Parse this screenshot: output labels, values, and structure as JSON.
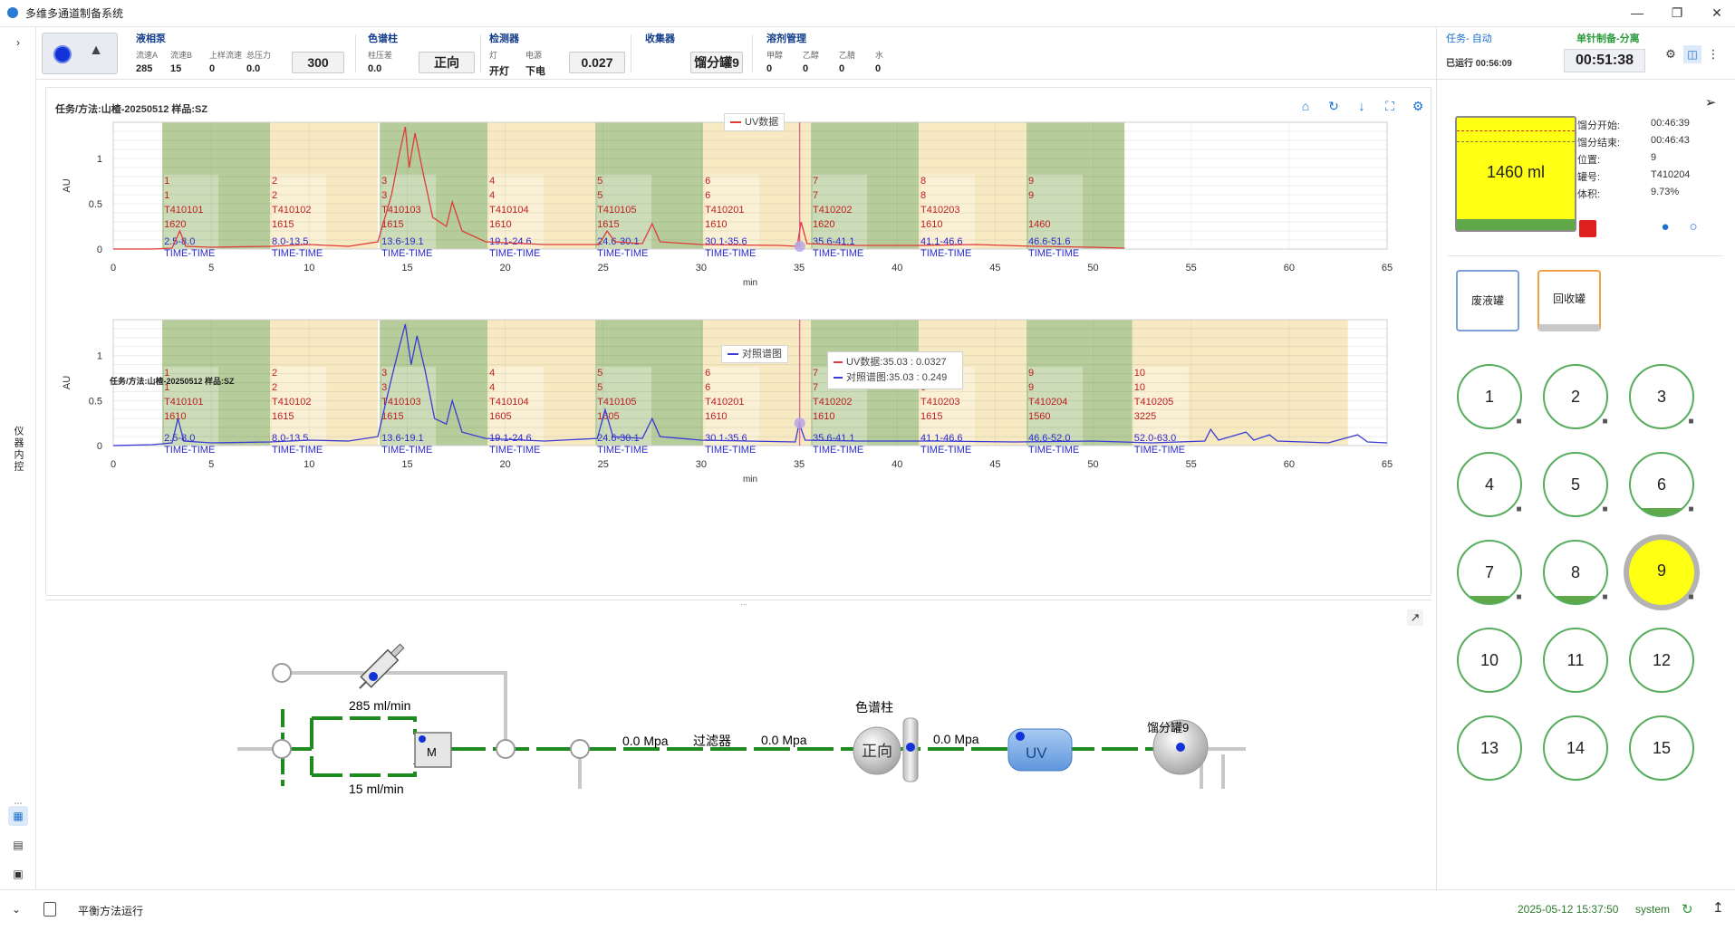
{
  "window": {
    "title": "多维多通道制备系统"
  },
  "left_rail": {
    "vertical_label": "仪器内控"
  },
  "toolbar": {
    "pump": {
      "title": "液相泵",
      "labels": [
        "流速A",
        "流速B",
        "上样流速",
        "总压力"
      ],
      "values": [
        "285",
        "15",
        "0",
        "0.0"
      ],
      "box": "300"
    },
    "column": {
      "title": "色谱柱",
      "label": "柱压差",
      "value": "0.0",
      "box": "正向"
    },
    "detector": {
      "title": "检测器",
      "labels": [
        "灯",
        "电源"
      ],
      "values": [
        "开灯",
        "下电"
      ],
      "box": "0.027"
    },
    "collector": {
      "title": "收集器",
      "box": "馏分罐9"
    },
    "solvent": {
      "title": "溶剂管理",
      "labels": [
        "甲醇",
        "乙醇",
        "乙腈",
        "水"
      ],
      "values": [
        "0",
        "0",
        "0",
        "0"
      ]
    }
  },
  "task": {
    "label": "任务- 自动",
    "mode": "单针制备-分离",
    "elapsed_label": "已运行 00:56:09",
    "timer": "00:51:38"
  },
  "chart1": {
    "title": "任务/方法:山楂-20250512 样品:SZ",
    "legend": "UV数据"
  },
  "chart2": {
    "title": "任务/方法:山楂-20250512 样品:SZ",
    "legend": "对照谱图",
    "tooltip": [
      "UV数据:35.03 : 0.0327",
      "对照谱图:35.03 : 0.249"
    ]
  },
  "chart_data": [
    {
      "type": "line",
      "title": "任务/方法:山楂-20250512 样品:SZ",
      "xlabel": "min",
      "ylabel": "AU",
      "xlim": [
        0,
        65
      ],
      "ylim": [
        0,
        1.4
      ],
      "x_ticks": [
        0,
        5,
        10,
        15,
        20,
        25,
        30,
        35,
        40,
        45,
        50,
        55,
        60,
        65
      ],
      "y_ticks": [
        0,
        0.5,
        1
      ],
      "series": [
        {
          "name": "UV数据",
          "color": "#e03b3b",
          "points": [
            [
              0,
              0
            ],
            [
              2,
              0
            ],
            [
              3,
              0.01
            ],
            [
              3.4,
              0.2
            ],
            [
              3.7,
              0.03
            ],
            [
              5,
              0.02
            ],
            [
              8,
              0.03
            ],
            [
              10,
              0.05
            ],
            [
              12,
              0.03
            ],
            [
              13.5,
              0.08
            ],
            [
              14.2,
              0.6
            ],
            [
              14.6,
              1.05
            ],
            [
              14.9,
              1.35
            ],
            [
              15.1,
              0.9
            ],
            [
              15.4,
              1.28
            ],
            [
              15.8,
              0.85
            ],
            [
              16.3,
              0.35
            ],
            [
              17,
              0.25
            ],
            [
              17.3,
              0.52
            ],
            [
              17.8,
              0.2
            ],
            [
              19,
              0.08
            ],
            [
              22,
              0.05
            ],
            [
              24.8,
              0.05
            ],
            [
              25.2,
              0.2
            ],
            [
              25.6,
              0.08
            ],
            [
              27,
              0.06
            ],
            [
              27.5,
              0.28
            ],
            [
              27.9,
              0.08
            ],
            [
              30,
              0.05
            ],
            [
              34,
              0.04
            ],
            [
              34.9,
              0.03
            ],
            [
              35.1,
              0.3
            ],
            [
              35.4,
              0.06
            ],
            [
              38,
              0.04
            ],
            [
              41,
              0.04
            ],
            [
              44,
              0.05
            ],
            [
              47,
              0.03
            ],
            [
              50,
              0.02
            ],
            [
              51.6,
              0.01
            ]
          ]
        }
      ],
      "fractions": [
        {
          "no": "1",
          "ch": "1",
          "tube": "T410101",
          "vol": "1620",
          "range": "2.5-8.0",
          "start": 2.5,
          "end": 8.0
        },
        {
          "no": "2",
          "ch": "2",
          "tube": "T410102",
          "vol": "1615",
          "range": "8.0-13.5",
          "start": 8.0,
          "end": 13.5
        },
        {
          "no": "3",
          "ch": "3",
          "tube": "T410103",
          "vol": "1615",
          "range": "13.6-19.1",
          "start": 13.6,
          "end": 19.1
        },
        {
          "no": "4",
          "ch": "4",
          "tube": "T410104",
          "vol": "1610",
          "range": "19.1-24.6",
          "start": 19.1,
          "end": 24.6
        },
        {
          "no": "5",
          "ch": "5",
          "tube": "T410105",
          "vol": "1615",
          "range": "24.6-30.1",
          "start": 24.6,
          "end": 30.1
        },
        {
          "no": "6",
          "ch": "6",
          "tube": "T410201",
          "vol": "1610",
          "range": "30.1-35.6",
          "start": 30.1,
          "end": 35.6
        },
        {
          "no": "7",
          "ch": "7",
          "tube": "T410202",
          "vol": "1620",
          "range": "35.6-41.1",
          "start": 35.6,
          "end": 41.1
        },
        {
          "no": "8",
          "ch": "8",
          "tube": "T410203",
          "vol": "1610",
          "range": "41.1-46.6",
          "start": 41.1,
          "end": 46.6
        },
        {
          "no": "9",
          "ch": "9",
          "tube": "",
          "vol": "1460",
          "range": "46.6-51.6",
          "start": 46.6,
          "end": 51.6
        }
      ],
      "fraction_suffix": "TIME-TIME",
      "cursor_x": 35.03
    },
    {
      "type": "line",
      "title": "任务/方法:山楂-20250512 样品:SZ",
      "xlabel": "min",
      "ylabel": "AU",
      "xlim": [
        0,
        65
      ],
      "ylim": [
        0,
        1.4
      ],
      "x_ticks": [
        0,
        5,
        10,
        15,
        20,
        25,
        30,
        35,
        40,
        45,
        50,
        55,
        60,
        65
      ],
      "y_ticks": [
        0,
        0.5,
        1
      ],
      "series": [
        {
          "name": "对照谱图",
          "color": "#3a3ad6",
          "points": [
            [
              0,
              0
            ],
            [
              2,
              0.01
            ],
            [
              3,
              0.03
            ],
            [
              3.3,
              0.3
            ],
            [
              3.6,
              0.05
            ],
            [
              5,
              0.03
            ],
            [
              8,
              0.04
            ],
            [
              10,
              0.06
            ],
            [
              12,
              0.05
            ],
            [
              13.5,
              0.1
            ],
            [
              14.2,
              0.75
            ],
            [
              14.6,
              1.1
            ],
            [
              14.9,
              1.35
            ],
            [
              15.2,
              0.9
            ],
            [
              15.5,
              1.22
            ],
            [
              15.9,
              0.85
            ],
            [
              16.4,
              0.3
            ],
            [
              17,
              0.24
            ],
            [
              17.3,
              0.5
            ],
            [
              17.8,
              0.15
            ],
            [
              19,
              0.08
            ],
            [
              22,
              0.05
            ],
            [
              24.7,
              0.08
            ],
            [
              25.1,
              0.4
            ],
            [
              25.5,
              0.1
            ],
            [
              27,
              0.08
            ],
            [
              27.5,
              0.3
            ],
            [
              27.9,
              0.1
            ],
            [
              30,
              0.06
            ],
            [
              34.8,
              0.04
            ],
            [
              35.0,
              0.25
            ],
            [
              35.3,
              0.06
            ],
            [
              38,
              0.05
            ],
            [
              42,
              0.05
            ],
            [
              46,
              0.04
            ],
            [
              50,
              0.05
            ],
            [
              53,
              0.03
            ],
            [
              55.7,
              0.05
            ],
            [
              56,
              0.18
            ],
            [
              56.4,
              0.06
            ],
            [
              57.8,
              0.15
            ],
            [
              58.2,
              0.06
            ],
            [
              59,
              0.12
            ],
            [
              59.4,
              0.05
            ],
            [
              62,
              0.03
            ],
            [
              63.5,
              0.12
            ],
            [
              64,
              0.04
            ],
            [
              65,
              0.03
            ]
          ]
        }
      ],
      "fractions": [
        {
          "no": "1",
          "ch": "1",
          "tube": "T410101",
          "vol": "1610",
          "range": "2.5-8.0",
          "start": 2.5,
          "end": 8.0
        },
        {
          "no": "2",
          "ch": "2",
          "tube": "T410102",
          "vol": "1615",
          "range": "8.0-13.5",
          "start": 8.0,
          "end": 13.5
        },
        {
          "no": "3",
          "ch": "3",
          "tube": "T410103",
          "vol": "1615",
          "range": "13.6-19.1",
          "start": 13.6,
          "end": 19.1
        },
        {
          "no": "4",
          "ch": "4",
          "tube": "T410104",
          "vol": "1605",
          "range": "19.1-24.6",
          "start": 19.1,
          "end": 24.6
        },
        {
          "no": "5",
          "ch": "5",
          "tube": "T410105",
          "vol": "1605",
          "range": "24.6-30.1",
          "start": 24.6,
          "end": 30.1
        },
        {
          "no": "6",
          "ch": "6",
          "tube": "T410201",
          "vol": "1610",
          "range": "30.1-35.6",
          "start": 30.1,
          "end": 35.6
        },
        {
          "no": "7",
          "ch": "7",
          "tube": "T410202",
          "vol": "1610",
          "range": "35.6-41.1",
          "start": 35.6,
          "end": 41.1
        },
        {
          "no": "8",
          "ch": "8",
          "tube": "T410203",
          "vol": "1615",
          "range": "41.1-46.6",
          "start": 41.1,
          "end": 46.6
        },
        {
          "no": "9",
          "ch": "9",
          "tube": "T410204",
          "vol": "1560",
          "range": "46.6-52.0",
          "start": 46.6,
          "end": 52.0
        },
        {
          "no": "10",
          "ch": "10",
          "tube": "T410205",
          "vol": "3225",
          "range": "52.0-63.0",
          "start": 52.0,
          "end": 63.0
        }
      ],
      "fraction_suffix": "TIME-TIME",
      "cursor_x": 35.03
    }
  ],
  "flow": {
    "flow_a": "285 ml/min",
    "flow_b": "15 ml/min",
    "mixer": "M",
    "pressure1": "0.0 Mpa",
    "filter": "过滤器",
    "pressure2": "0.0 Mpa",
    "column_label": "色谱柱",
    "column_dir": "正向",
    "pressure3": "0.0 Mpa",
    "uv": "UV",
    "tank": "馏分罐9"
  },
  "fraction_info": {
    "tube_volume": "1460 ml",
    "keys": [
      "馏分开始:",
      "馏分结束:",
      "位置:",
      "罐号:",
      "体积:"
    ],
    "values": [
      "00:46:39",
      "00:46:43",
      "9",
      "T410204",
      "9.73%"
    ]
  },
  "tanks": {
    "waste": "废液罐",
    "recycle": "回收罐"
  },
  "positions": [
    "1",
    "2",
    "3",
    "4",
    "5",
    "6",
    "7",
    "8",
    "9",
    "10",
    "11",
    "12",
    "13",
    "14",
    "15"
  ],
  "footer": {
    "status": "平衡方法运行",
    "datetime": "2025-05-12 15:37:50",
    "user": "system"
  },
  "colors": {
    "accent": "#1a6fd0",
    "green_band": "#a9c48a",
    "yellow_band": "#f6e6b8",
    "uv_line": "#e03b3b",
    "ref_line": "#3a3ad6",
    "pipe": "#1f8a1f"
  }
}
